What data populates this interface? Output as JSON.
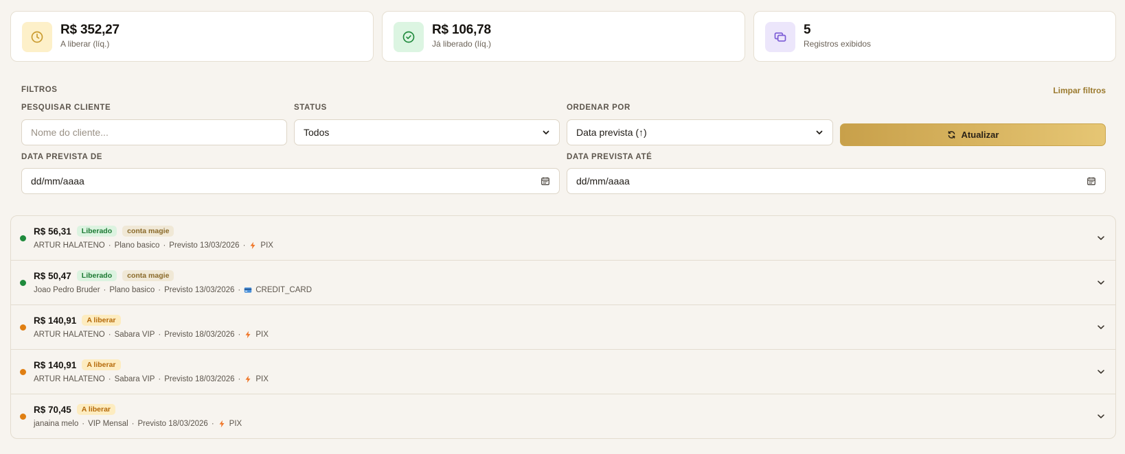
{
  "summary": {
    "cards": [
      {
        "value": "R$ 352,27",
        "label": "A liberar (líq.)",
        "icon": "clock-icon",
        "icon_bg": "#fdf0c9",
        "icon_color": "#c99a2e"
      },
      {
        "value": "R$ 106,78",
        "label": "Já liberado (líq.)",
        "icon": "check-circle-icon",
        "icon_bg": "#dcf5e2",
        "icon_color": "#1f8a3c"
      },
      {
        "value": "5",
        "label": "Registros exibidos",
        "icon": "stack-icon",
        "icon_bg": "#ece6fb",
        "icon_color": "#7b5bd6"
      }
    ]
  },
  "filters": {
    "title": "FILTROS",
    "clear_label": "Limpar filtros",
    "search": {
      "label": "PESQUISAR CLIENTE",
      "placeholder": "Nome do cliente...",
      "value": ""
    },
    "status": {
      "label": "STATUS",
      "selected": "Todos"
    },
    "order": {
      "label": "ORDENAR POR",
      "selected": "Data prevista (↑)"
    },
    "refresh_label": "Atualizar",
    "date_from": {
      "label": "DATA PREVISTA DE",
      "value": "dd/mm/aaaa"
    },
    "date_to": {
      "label": "DATA PREVISTA ATÉ",
      "value": "dd/mm/aaaa"
    }
  },
  "records": [
    {
      "amount": "R$ 56,31",
      "status": "Liberado",
      "status_type": "released",
      "tag": "conta magie",
      "client": "ARTUR HALATENO",
      "plan": "Plano basico",
      "expected": "Previsto 13/03/2026",
      "method": "PIX",
      "method_icon": "bolt-icon"
    },
    {
      "amount": "R$ 50,47",
      "status": "Liberado",
      "status_type": "released",
      "tag": "conta magie",
      "client": "Joao Pedro Bruder",
      "plan": "Plano basico",
      "expected": "Previsto 13/03/2026",
      "method": "CREDIT_CARD",
      "method_icon": "credit-card-icon"
    },
    {
      "amount": "R$ 140,91",
      "status": "A liberar",
      "status_type": "pending",
      "tag": "",
      "client": "ARTUR HALATENO",
      "plan": "Sabara VIP",
      "expected": "Previsto 18/03/2026",
      "method": "PIX",
      "method_icon": "bolt-icon"
    },
    {
      "amount": "R$ 140,91",
      "status": "A liberar",
      "status_type": "pending",
      "tag": "",
      "client": "ARTUR HALATENO",
      "plan": "Sabara VIP",
      "expected": "Previsto 18/03/2026",
      "method": "PIX",
      "method_icon": "bolt-icon"
    },
    {
      "amount": "R$ 70,45",
      "status": "A liberar",
      "status_type": "pending",
      "tag": "",
      "client": "janaina melo",
      "plan": "VIP Mensal",
      "expected": "Previsto 18/03/2026",
      "method": "PIX",
      "method_icon": "bolt-icon"
    }
  ],
  "colors": {
    "released_dot": "#1f8a3c",
    "pending_dot": "#e07f12",
    "accent_gold": "#c8a04a",
    "bolt": "#f0772a"
  }
}
